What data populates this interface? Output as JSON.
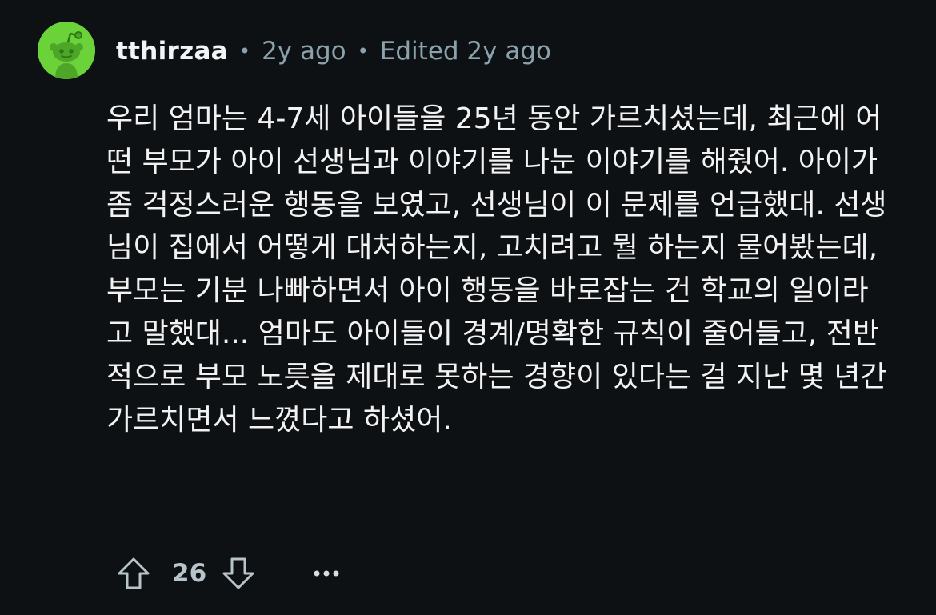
{
  "comment": {
    "username": "tthirzaa",
    "posted": "2y ago",
    "edited": "Edited 2y ago",
    "separator": "•",
    "body": "우리 엄마는 4-7세 아이들을 25년 동안 가르치셨는데, 최근에 어떤 부모가 아이 선생님과 이야기를 나눈 이야기를 해줬어. 아이가 좀 걱정스러운 행동을 보였고, 선생님이 이 문제를 언급했대. 선생님이 집에서 어떻게 대처하는지, 고치려고 뭘 하는지 물어봤는데, 부모는 기분 나빠하면서 아이 행동을 바로잡는 건 학교의 일이라고 말했대... 엄마도 아이들이 경계/명확한 규칙이 줄어들고, 전반적으로 부모 노릇을 제대로 못하는 경향이 있다는 걸 지난 몇 년간 가르치면서 느꼈다고 하셨어.",
    "score": "26",
    "icons": {
      "avatar": "reddit-snoo-avatar-icon",
      "upvote": "upvote-arrow-icon",
      "downvote": "downvote-arrow-icon",
      "more": "more-options-icon"
    },
    "colors": {
      "background": "#0e1113",
      "avatar": "#6bd23a",
      "muted": "#8ba2ad"
    }
  }
}
